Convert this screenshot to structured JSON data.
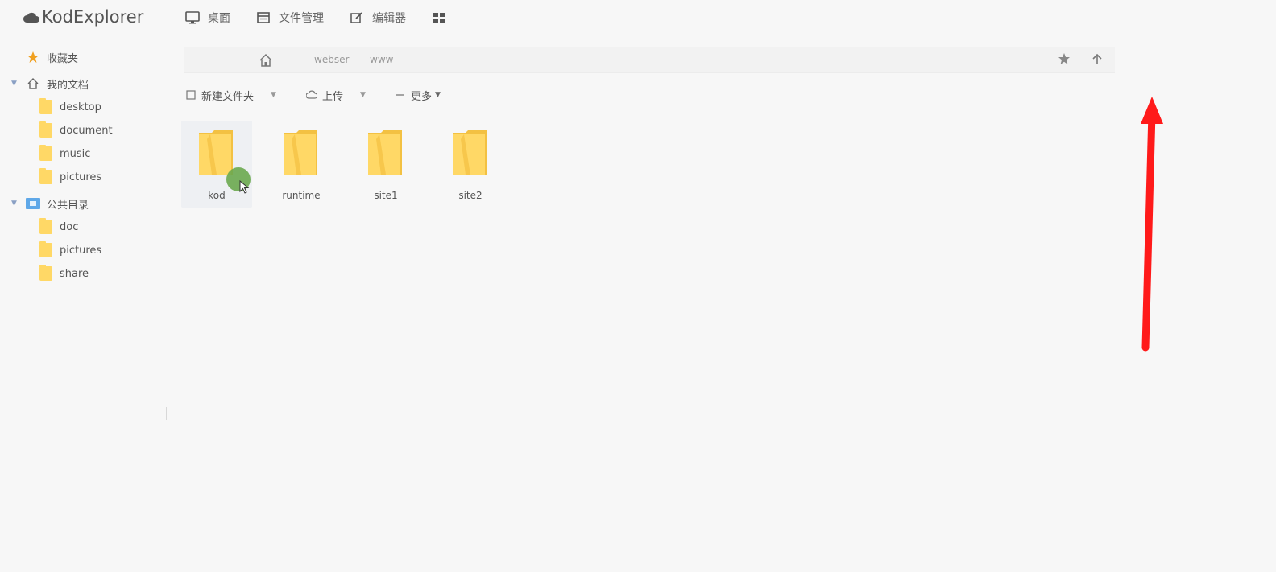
{
  "app": {
    "title": "KodExplorer"
  },
  "topnav": [
    {
      "label": "桌面",
      "icon": "desktop-monitor-icon"
    },
    {
      "label": "文件管理",
      "icon": "file-manager-icon"
    },
    {
      "label": "编辑器",
      "icon": "editor-pen-icon"
    },
    {
      "label": "",
      "icon": "grid-apps-icon"
    }
  ],
  "sidebar": {
    "favorites": {
      "label": "收藏夹",
      "icon": "star-icon"
    },
    "my_docs": {
      "label": "我的文档",
      "icon": "home-icon",
      "children": [
        "desktop",
        "document",
        "music",
        "pictures"
      ]
    },
    "public": {
      "label": "公共目录",
      "icon": "public-folder-icon",
      "children": [
        "doc",
        "pictures",
        "share"
      ]
    }
  },
  "pathbar": {
    "crumbs": [
      "webser",
      "www"
    ],
    "home_icon": "home-icon",
    "favorite_icon": "star-icon",
    "up_icon": "arrow-up-icon"
  },
  "toolbar": {
    "new_folder": "新建文件夹",
    "upload": "上传",
    "more": "更多"
  },
  "files": [
    {
      "name": "kod",
      "selected": true
    },
    {
      "name": "runtime",
      "selected": false
    },
    {
      "name": "site1",
      "selected": false
    },
    {
      "name": "site2",
      "selected": false
    }
  ],
  "colors": {
    "folder": "#ffd866",
    "folder_dark": "#f3c142",
    "star": "#f0a020",
    "annotation": "#ff1a1a",
    "cursor_highlight": "#6aa84f"
  }
}
